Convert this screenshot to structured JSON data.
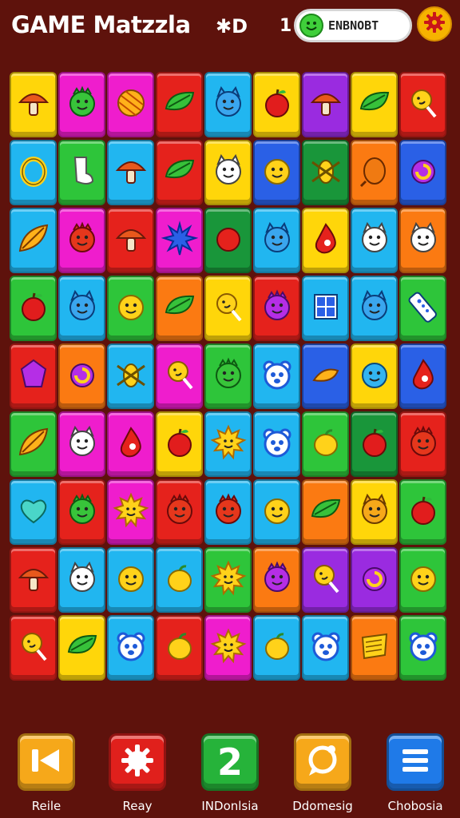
{
  "header": {
    "title": "GAME Matzzla",
    "moves_icon": "✱D",
    "coin_count": "1",
    "pill_text": "ENBNOBT",
    "settings_icon": "gear-icon"
  },
  "colors": {
    "background": "#5e120c",
    "yellow": "#ffd60a",
    "magenta": "#ef1dcd",
    "red": "#e5221c",
    "cyan": "#21b6f0",
    "green": "#2ec53a",
    "blue": "#2a60e6",
    "orange": "#fb7a12",
    "purple": "#9a2be0",
    "darkgreen": "#19963a"
  },
  "board": {
    "rows": 9,
    "cols": 9,
    "tiles": [
      [
        [
          "yellow",
          "mushroom"
        ],
        [
          "magenta",
          "green-monster"
        ],
        [
          "magenta",
          "orange-ball"
        ],
        [
          "red",
          "leaf"
        ],
        [
          "cyan",
          "blue-cat"
        ],
        [
          "yellow",
          "apple"
        ],
        [
          "purple",
          "mushroom"
        ],
        [
          "yellow",
          "leaf"
        ],
        [
          "red",
          "lollipop"
        ]
      ],
      [
        [
          "cyan",
          "ring"
        ],
        [
          "green",
          "sock"
        ],
        [
          "cyan",
          "mushroom"
        ],
        [
          "red",
          "leaf"
        ],
        [
          "yellow",
          "white-cat"
        ],
        [
          "blue",
          "yellow-smiley"
        ],
        [
          "darkgreen",
          "bug"
        ],
        [
          "orange",
          "egg"
        ],
        [
          "blue",
          "purple-ring"
        ]
      ],
      [
        [
          "cyan",
          "star-leaf"
        ],
        [
          "magenta",
          "red-monster"
        ],
        [
          "red",
          "mushroom"
        ],
        [
          "magenta",
          "blue-spiky"
        ],
        [
          "darkgreen",
          "red-blob"
        ],
        [
          "cyan",
          "blue-cat"
        ],
        [
          "yellow",
          "drop"
        ],
        [
          "cyan",
          "white-cat"
        ],
        [
          "orange",
          "white-cat"
        ]
      ],
      [
        [
          "green",
          "apple"
        ],
        [
          "cyan",
          "blue-cat"
        ],
        [
          "green",
          "yellow-smiley"
        ],
        [
          "orange",
          "leaf"
        ],
        [
          "yellow",
          "lollipop"
        ],
        [
          "red",
          "purple-monster"
        ],
        [
          "cyan",
          "window"
        ],
        [
          "cyan",
          "blue-cat"
        ],
        [
          "green",
          "remote"
        ]
      ],
      [
        [
          "red",
          "purple-gem"
        ],
        [
          "orange",
          "purple-ring"
        ],
        [
          "cyan",
          "bug"
        ],
        [
          "magenta",
          "lollipop"
        ],
        [
          "green",
          "green-monster"
        ],
        [
          "cyan",
          "blue-bear"
        ],
        [
          "blue",
          "yellow-bird"
        ],
        [
          "yellow",
          "blue-smiley"
        ],
        [
          "blue",
          "drop"
        ]
      ],
      [
        [
          "green",
          "star-leaf"
        ],
        [
          "magenta",
          "white-cat"
        ],
        [
          "magenta",
          "drop"
        ],
        [
          "yellow",
          "apple"
        ],
        [
          "cyan",
          "sun"
        ],
        [
          "cyan",
          "blue-bear"
        ],
        [
          "green",
          "lemon"
        ],
        [
          "darkgreen",
          "apple"
        ],
        [
          "red",
          "red-monster"
        ]
      ],
      [
        [
          "cyan",
          "heart"
        ],
        [
          "red",
          "green-monster"
        ],
        [
          "magenta",
          "sun"
        ],
        [
          "red",
          "red-monster"
        ],
        [
          "cyan",
          "red-monster"
        ],
        [
          "cyan",
          "yellow-smiley"
        ],
        [
          "orange",
          "leaf"
        ],
        [
          "yellow",
          "orange-cat"
        ],
        [
          "green",
          "apple"
        ]
      ],
      [
        [
          "red",
          "mushroom"
        ],
        [
          "cyan",
          "white-cat"
        ],
        [
          "cyan",
          "yellow-smiley"
        ],
        [
          "cyan",
          "lemon"
        ],
        [
          "green",
          "sun"
        ],
        [
          "orange",
          "purple-monster"
        ],
        [
          "purple",
          "lollipop"
        ],
        [
          "purple",
          "purple-ring"
        ],
        [
          "green",
          "yellow-smiley"
        ]
      ],
      [
        [
          "red",
          "lollipop"
        ],
        [
          "yellow",
          "leaf"
        ],
        [
          "cyan",
          "blue-bear"
        ],
        [
          "red",
          "lemon"
        ],
        [
          "magenta",
          "sun"
        ],
        [
          "cyan",
          "lemon"
        ],
        [
          "cyan",
          "blue-bear"
        ],
        [
          "orange",
          "tape"
        ],
        [
          "green",
          "blue-bear"
        ]
      ]
    ]
  },
  "nav": [
    {
      "label": "Reile",
      "color": "#f6a81a",
      "icon": "rewind-icon"
    },
    {
      "label": "Reay",
      "color": "#e0201c",
      "icon": "gear-icon"
    },
    {
      "label": "INDonlsia",
      "color": "#26b33a",
      "icon": "number-two-icon",
      "glyph": "2"
    },
    {
      "label": "Ddomesig",
      "color": "#f6a81a",
      "icon": "chat-bubble-icon"
    },
    {
      "label": "Chobosia",
      "color": "#1f7ae8",
      "icon": "menu-icon"
    }
  ]
}
